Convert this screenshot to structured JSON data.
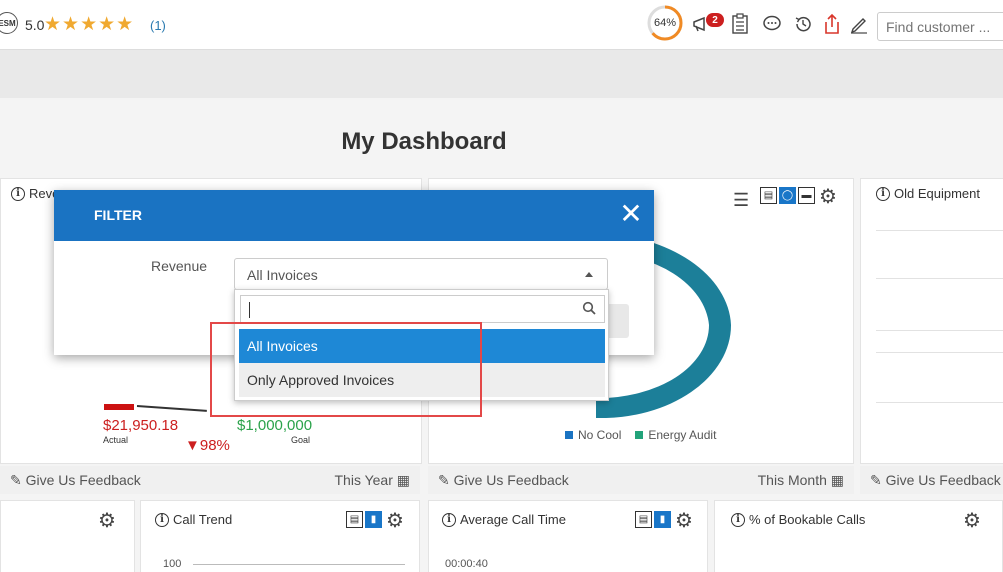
{
  "header": {
    "logo_text": "ESM",
    "rating": "5.0",
    "stars": "★★★★★",
    "rating_count": "(1)",
    "progress": "64%",
    "notification_count": "2",
    "search_placeholder": "Find customer ..."
  },
  "page_title": "My Dashboard",
  "panels": {
    "revenue": {
      "title": "Reve",
      "actual_value": "$21,950.18",
      "actual_label": "Actual",
      "goal_value": "$1,000,000",
      "goal_label": "Goal",
      "change": "▼98%",
      "feedback": "Give Us Feedback",
      "period": "This Year"
    },
    "middle": {
      "legend": [
        "No Cool",
        "Energy Audit"
      ],
      "feedback": "Give Us Feedback",
      "period": "This Month"
    },
    "old_equipment": {
      "title": "Old Equipment",
      "feedback": "Give Us Feedback"
    },
    "call_trend": {
      "title": "Call Trend",
      "axis_top": "100"
    },
    "avg_call_time": {
      "title": "Average Call Time",
      "axis_top": "00:00:40"
    },
    "bookable_calls": {
      "title": "% of Bookable Calls"
    }
  },
  "modal": {
    "title": "FILTER",
    "field_label": "Revenue",
    "selected": "All Invoices",
    "options": [
      "All Invoices",
      "Only Approved Invoices"
    ]
  },
  "colors": {
    "brand_blue": "#1a73c2",
    "selected_option": "#1e88d6",
    "donut": "#1c7f99",
    "legend_no_cool": "#1a73c2",
    "legend_energy_audit": "#22a37a",
    "highlight": "#e34848"
  }
}
